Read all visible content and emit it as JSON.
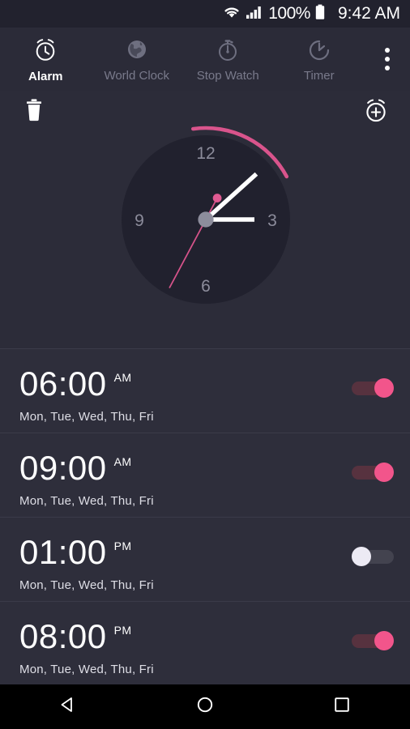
{
  "status_bar": {
    "wifi_icon": "wifi-icon",
    "signal_icon": "cellular-signal-icon",
    "battery_percent": "100%",
    "battery_icon": "battery-full-icon",
    "time": "9:42 AM"
  },
  "tabs": [
    {
      "label": "Alarm",
      "icon": "alarm-clock-icon",
      "active": true
    },
    {
      "label": "World Clock",
      "icon": "globe-icon",
      "active": false
    },
    {
      "label": "Stop Watch",
      "icon": "stopwatch-icon",
      "active": false
    },
    {
      "label": "Timer",
      "icon": "timer-icon",
      "active": false
    }
  ],
  "overflow_menu_icon": "more-vertical-icon",
  "actions": {
    "delete_icon": "trash-icon",
    "add_icon": "add-alarm-icon"
  },
  "analog_clock": {
    "numerals": [
      "12",
      "3",
      "6",
      "9"
    ],
    "hour_hand_angle_deg": 48,
    "minute_hand_angle_deg": 90,
    "second_hand_angle_deg": 208,
    "arc_start_deg": 352,
    "arc_end_deg": 62,
    "face_color": "#21212e",
    "hand_color": "#ffffff",
    "second_hand_color": "#d6538a",
    "arc_color": "#d9548c",
    "hub_color": "#8d8d9c",
    "numeral_color": "#8c8c9b"
  },
  "alarms": [
    {
      "time": "06:00",
      "meridiem": "AM",
      "days": "Mon, Tue, Wed, Thu, Fri",
      "enabled": true
    },
    {
      "time": "09:00",
      "meridiem": "AM",
      "days": "Mon, Tue, Wed, Thu, Fri",
      "enabled": true
    },
    {
      "time": "01:00",
      "meridiem": "PM",
      "days": "Mon, Tue, Wed, Thu, Fri",
      "enabled": false
    },
    {
      "time": "08:00",
      "meridiem": "PM",
      "days": "Mon, Tue, Wed, Thu, Fri",
      "enabled": true
    }
  ],
  "nav_bar": {
    "back_icon": "back-triangle-icon",
    "home_icon": "home-circle-icon",
    "recents_icon": "recents-square-icon"
  },
  "colors": {
    "accent_pink": "#f2558b",
    "page_bg": "#2c2c39",
    "list_bg": "#2e2e3b",
    "divider": "#3b3b49"
  }
}
